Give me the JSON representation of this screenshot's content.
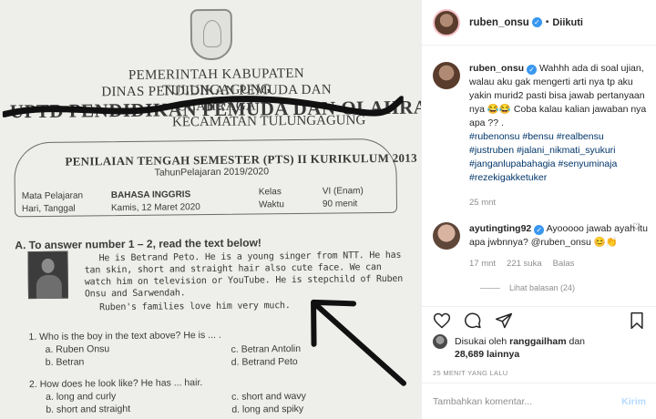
{
  "paper": {
    "gov": "PEMERINTAH KABUPATEN TULUNGAGUNG",
    "dinas": "DINAS PENDIDIKAN PEMUDA DAN OLAHRAGA",
    "uptd": "UPTD PENDIDIKAN PEMUDA DAN OLAHRAGA",
    "kecamatan": "KECAMATAN TULUNGAGUNG",
    "pts_title": "PENILAIAN TENGAH SEMESTER (PTS) II KURIKULUM 2013",
    "year": "TahunPelajaran 2019/2020",
    "mapel_label": "Mata Pelajaran",
    "mapel_value": "BAHASA INGGRIS",
    "date_label": "Hari, Tanggal",
    "date_value": "Kamis, 12 Maret 2020",
    "kelas_label": "Kelas",
    "kelas_value": "VI (Enam)",
    "waktu_label": "Waktu",
    "waktu_value": "90 menit",
    "section": "A.   To answer number 1 – 2, read the text below!",
    "reading_p1": "He is Betrand Peto. He is a young singer from NTT. He has tan skin, short and straight hair also cute face. We can watch him on television or YouTube. He is stepchild of Ruben Onsu and Sarwendah.",
    "reading_p2": "Ruben's families love him very much.",
    "q1": "1.   Who is the boy in the text above? He is ... .",
    "q1_a": "a.   Ruben Onsu",
    "q1_b": "b.   Betran",
    "q1_c": "c.   Betran Antolin",
    "q1_d": "d.   Betrand Peto",
    "q2": "2.   How does he look like? He has ... hair.",
    "q2_a": "a.   long and curly",
    "q2_b": "b.   short and straight",
    "q2_c": "c.   short and wavy",
    "q2_d": "d.   long and spiky"
  },
  "header": {
    "username": "ruben_onsu",
    "separator": "•",
    "follow_status": "Diikuti"
  },
  "caption": {
    "username": "ruben_onsu",
    "text": "Wahhh ada di soal ujian, walau aku gak mengerti arti nya tp aku yakin murid2 pasti bisa jawab pertanyaan nya 😂😂 Coba kalau kalian jawaban nya apa ?? .",
    "hashtags": "#rubenonsu #bensu #realbensu #justruben #jalani_nikmati_syukuri #janganlupabahagia #senyuminaja #rezekigakketuker",
    "time": "25 mnt"
  },
  "comment": {
    "username": "ayutingting92",
    "text": "Ayooooo jawab ayah itu apa jwbnnya? @ruben_onsu 😊👏",
    "time": "17 mnt",
    "likes": "221 suka",
    "reply": "Balas",
    "view_replies": "Lihat balasan (24)"
  },
  "likes": {
    "prefix": "Disukai oleh",
    "user": "ranggailham",
    "and": "dan",
    "count": "28,689 lainnya"
  },
  "posted_ago": "25 MENIT YANG LALU",
  "add_comment": {
    "placeholder": "Tambahkan komentar...",
    "post_label": "Kirim"
  },
  "colors": {
    "verified": "#3897f0",
    "hashtag": "#003569",
    "post_disabled": "#b3dbff",
    "muted": "#8e8e8e"
  }
}
